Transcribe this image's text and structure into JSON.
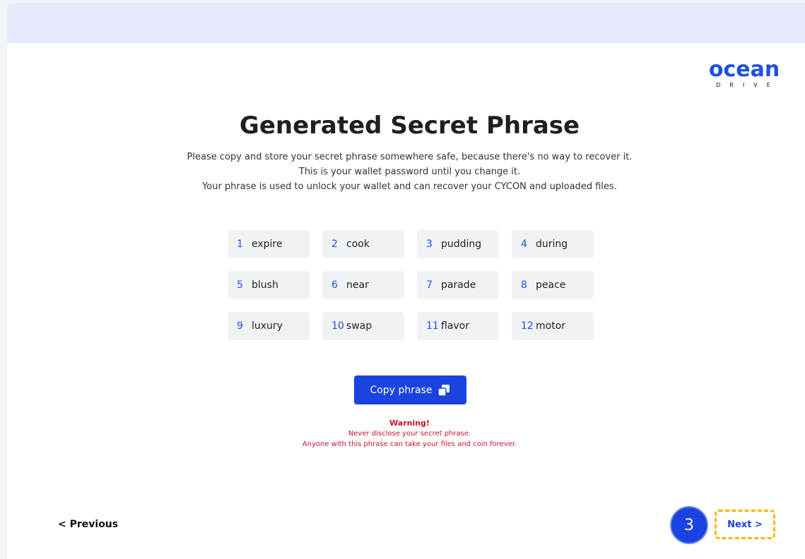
{
  "brand": {
    "logo_main": "ocean",
    "logo_sub": "DRIVE"
  },
  "page": {
    "title": "Generated Secret Phrase",
    "description": [
      "Please copy and store your secret phrase somewhere safe, because there's no way to recover it.",
      "This is your wallet password until you change it.",
      "Your phrase is used to unlock your wallet and can recover your CYCON and uploaded files."
    ]
  },
  "phrase": [
    {
      "num": "1",
      "word": "expire"
    },
    {
      "num": "2",
      "word": "cook"
    },
    {
      "num": "3",
      "word": "pudding"
    },
    {
      "num": "4",
      "word": "during"
    },
    {
      "num": "5",
      "word": "blush"
    },
    {
      "num": "6",
      "word": "near"
    },
    {
      "num": "7",
      "word": "parade"
    },
    {
      "num": "8",
      "word": "peace"
    },
    {
      "num": "9",
      "word": "luxury"
    },
    {
      "num": "10",
      "word": "swap"
    },
    {
      "num": "11",
      "word": "flavor"
    },
    {
      "num": "12",
      "word": "motor"
    }
  ],
  "copy_button": {
    "label": "Copy phrase",
    "icon": "copy-icon"
  },
  "warning": {
    "title": "Warning!",
    "lines": [
      "Never disclose your secret phrase.",
      "Anyone with this phrase can take your files and coin forever."
    ]
  },
  "nav": {
    "previous": "< Previous",
    "next": "Next >",
    "step_badge": "3"
  },
  "colors": {
    "accent": "#1a43e0",
    "warning": "#c8102e",
    "highlight": "#f5b800"
  }
}
